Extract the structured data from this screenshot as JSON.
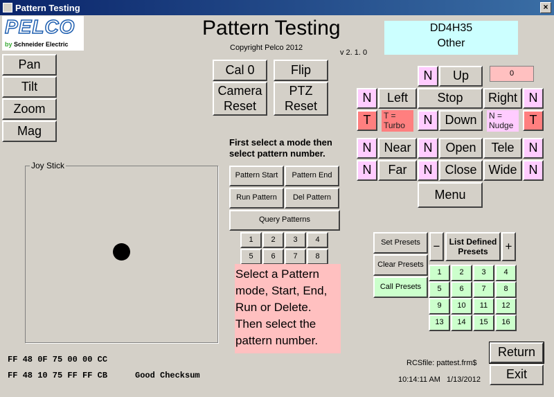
{
  "window": {
    "title": "Pattern Testing",
    "close_label": "×"
  },
  "logo": {
    "brand": "PELCO",
    "sub_by": "by",
    "sub_company": "Schneider Electric"
  },
  "header": {
    "title": "Pattern Testing",
    "copyright": "Copyright Pelco 2012",
    "version": "v 2. 1. 0"
  },
  "device": {
    "name": "DD4H35",
    "type": "Other"
  },
  "left_modes": [
    "Pan",
    "Tilt",
    "Zoom",
    "Mag"
  ],
  "joystick": {
    "label": "Joy Stick"
  },
  "top_buttons": {
    "cal0": "Cal 0",
    "flip": "Flip",
    "camera_reset": "Camera Reset",
    "ptz_reset": "PTZ Reset"
  },
  "pattern": {
    "instruction": "First select a mode then select  pattern number.",
    "start": "Pattern Start",
    "end": "Pattern End",
    "run": "Run Pattern",
    "del": "Del Pattern",
    "query": "Query Patterns",
    "numbers": [
      "1",
      "2",
      "3",
      "4",
      "5",
      "6",
      "7",
      "8"
    ],
    "help": "Select a Pattern mode, Start, End, Run or Delete. Then select the pattern number."
  },
  "ptz": {
    "speed_value": "0",
    "n": "N",
    "t": "T",
    "up": "Up",
    "left": "Left",
    "stop": "Stop",
    "right": "Right",
    "down": "Down",
    "turbo_note": "T = Turbo",
    "nudge_note": "N = Nudge",
    "near": "Near",
    "far": "Far",
    "open": "Open",
    "close": "Close",
    "tele": "Tele",
    "wide": "Wide",
    "menu": "Menu"
  },
  "presets": {
    "set": "Set Presets",
    "clear": "Clear Presets",
    "call": "Call Presets",
    "minus": "−",
    "plus": "+",
    "list": "List Defined Presets",
    "numbers": [
      "1",
      "2",
      "3",
      "4",
      "5",
      "6",
      "7",
      "8",
      "9",
      "10",
      "11",
      "12",
      "13",
      "14",
      "15",
      "16"
    ]
  },
  "status": {
    "hex1": "FF 48 0F 75 00 00 CC",
    "hex2": "FF 48 10 75 FF FF CB",
    "checksum": "Good Checksum",
    "rcsfile": "RCSfile: pattest.frm$",
    "time": "10:14:11 AM",
    "date": "1/13/2012"
  },
  "actions": {
    "return": "Return",
    "exit": "Exit"
  },
  "colors": {
    "background": "#d4d0c8",
    "nudge": "#ffccff",
    "turbo": "#ff7f7f",
    "device_panel": "#ccffff",
    "help_panel": "#ffc0c0",
    "preset_green": "#ccffcc"
  }
}
